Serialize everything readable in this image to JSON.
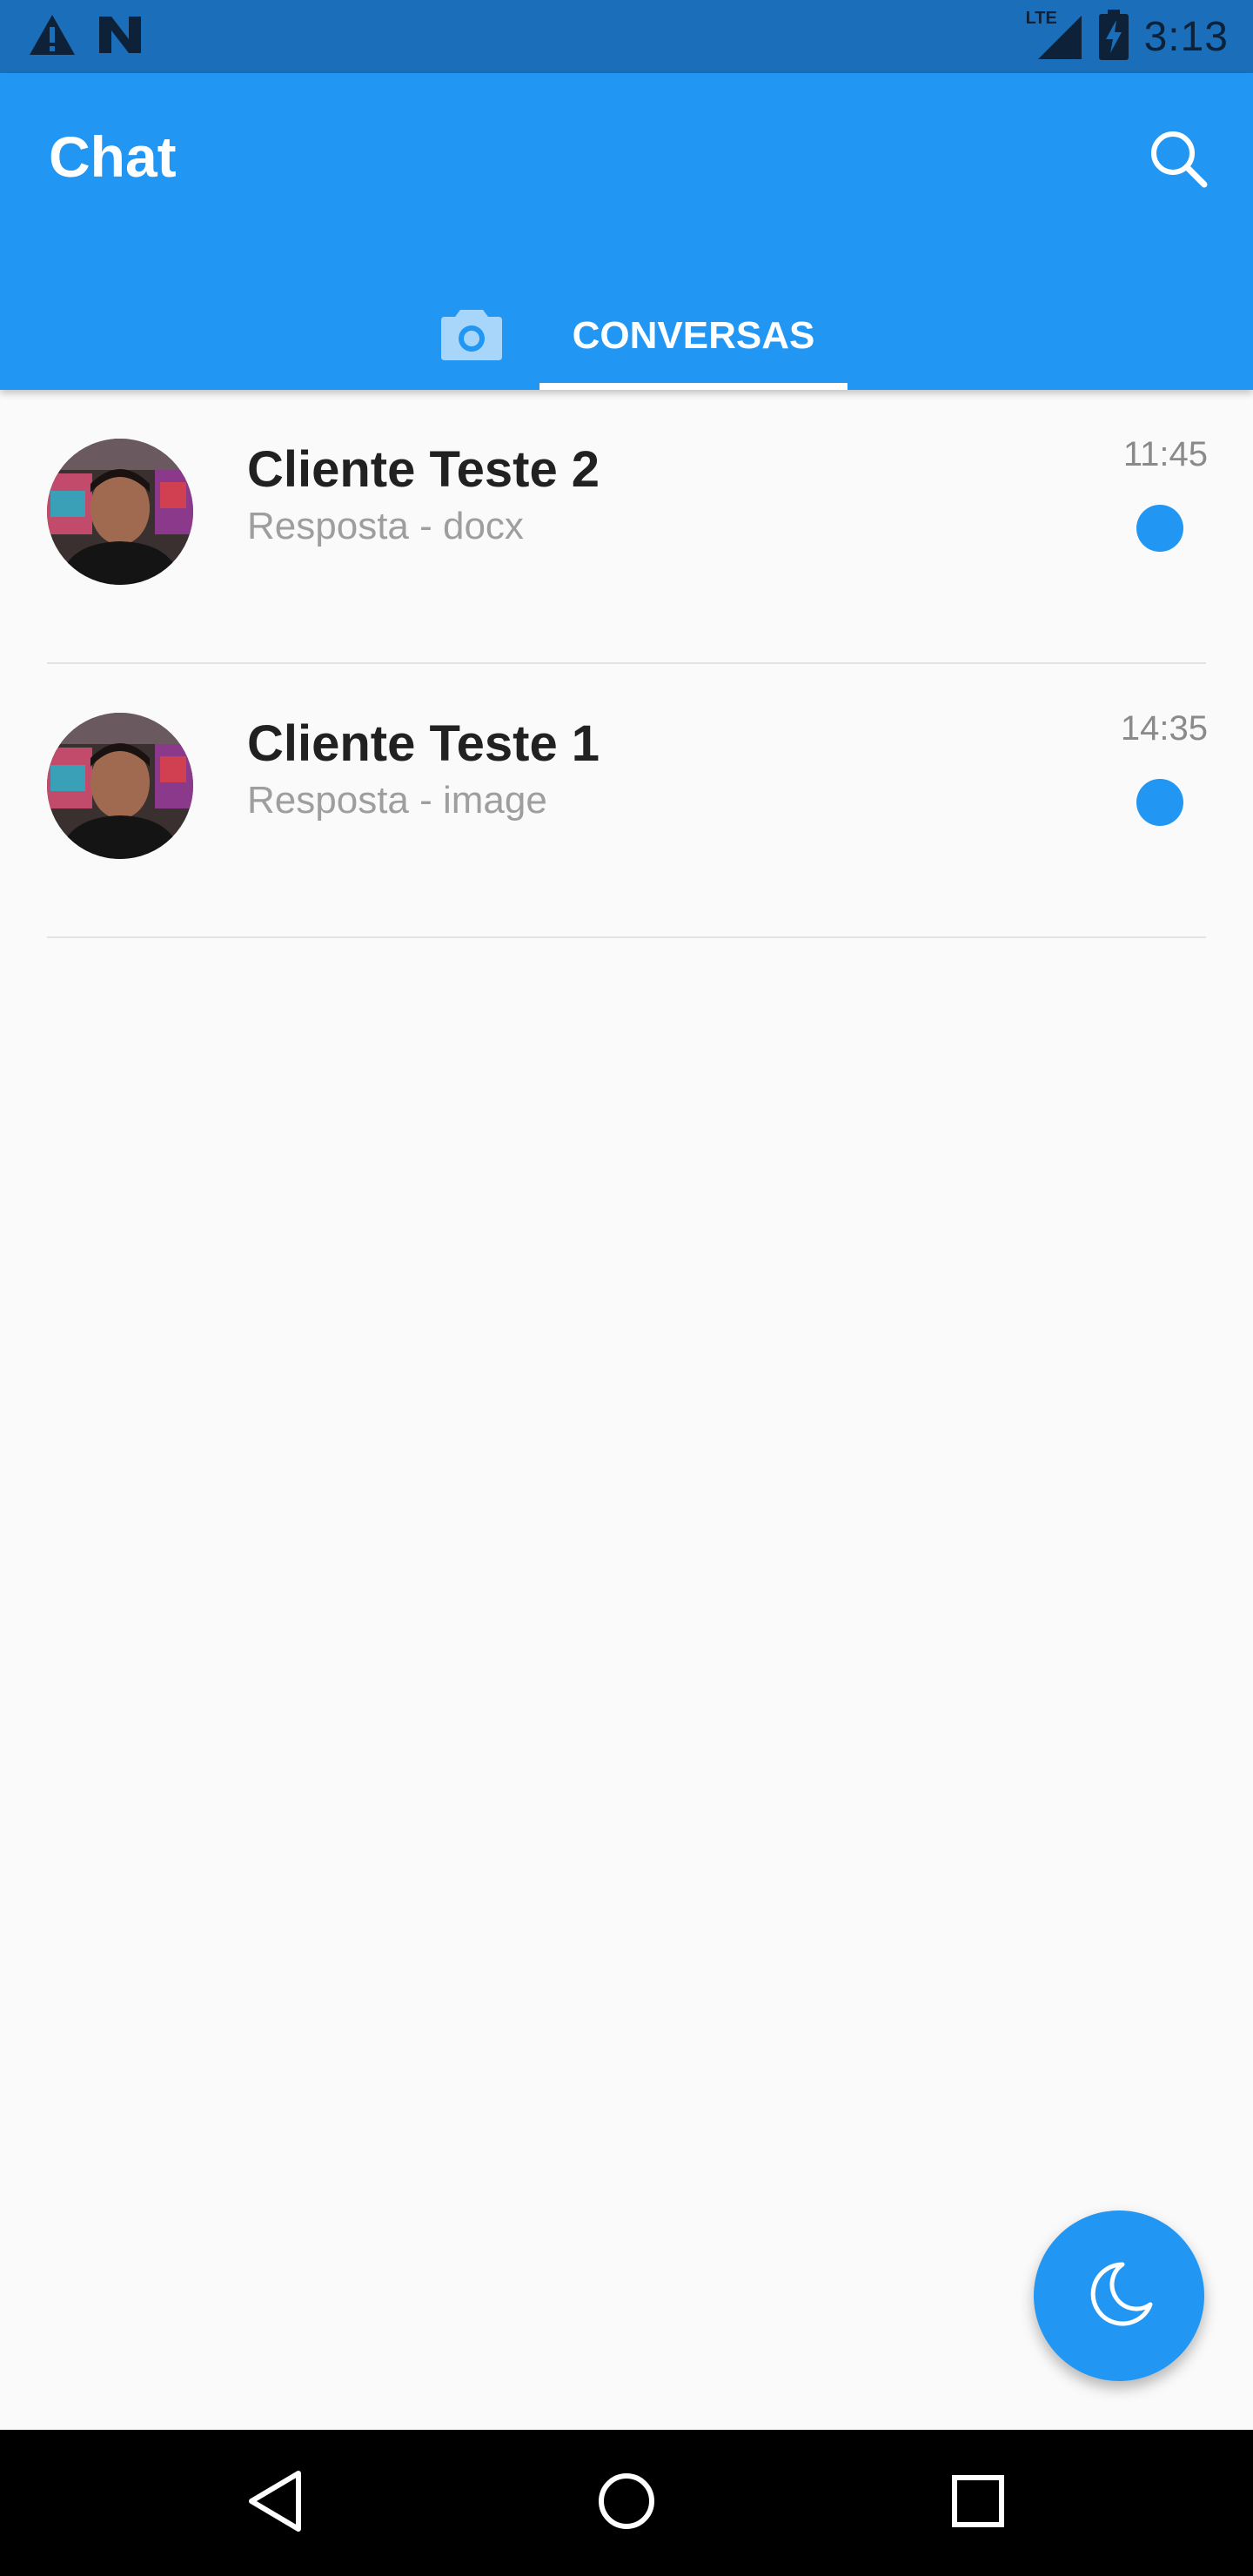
{
  "status_bar": {
    "time": "3:13",
    "network_label": "LTE",
    "icons": [
      "warning-icon",
      "n-notification-icon",
      "lte-signal-icon",
      "battery-charging-icon"
    ]
  },
  "app_bar": {
    "title": "Chat",
    "search_icon": "search-icon"
  },
  "tabs": [
    {
      "icon": "camera-icon",
      "label": ""
    },
    {
      "label": "CONVERSAS",
      "selected": true
    }
  ],
  "conversations": [
    {
      "name": "Cliente Teste 2",
      "preview": "Resposta - docx",
      "time": "11:45",
      "unread": true
    },
    {
      "name": "Cliente Teste 1",
      "preview": "Resposta - image",
      "time": "14:35",
      "unread": true
    }
  ],
  "fab": {
    "icon": "moon-icon"
  },
  "nav_bar": {
    "icons": [
      "back-icon",
      "home-icon",
      "recents-icon"
    ]
  },
  "colors": {
    "primary": "#2196f3",
    "status_bar": "#1b6fba",
    "background": "#fafafa",
    "unread_dot": "#2196f3"
  }
}
